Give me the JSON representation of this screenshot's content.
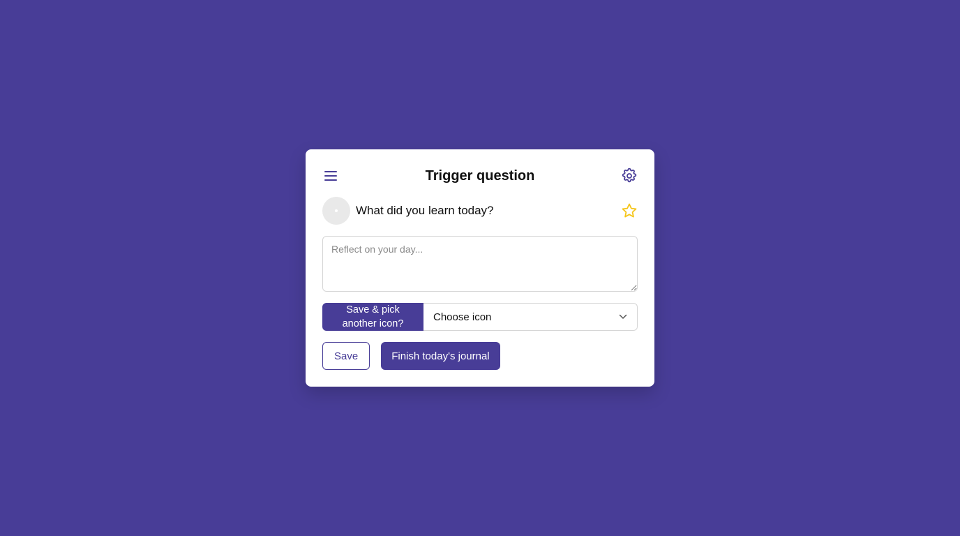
{
  "colors": {
    "background": "#483d97",
    "accent": "#483d97",
    "card": "#ffffff",
    "star": "#f5c518"
  },
  "header": {
    "title": "Trigger question",
    "menu_icon": "hamburger-menu-icon",
    "settings_icon": "gear-icon"
  },
  "question": {
    "text": "What did you learn today?",
    "avatar_icon": "avatar-placeholder",
    "favorite_icon": "star-outline-icon"
  },
  "entry": {
    "placeholder": "Reflect on your day..."
  },
  "icon_picker": {
    "save_pick_label": "Save & pick another icon?",
    "select_value": "Choose icon",
    "dropdown_icon": "chevron-down-icon"
  },
  "actions": {
    "save_label": "Save",
    "finish_label": "Finish today's journal"
  }
}
